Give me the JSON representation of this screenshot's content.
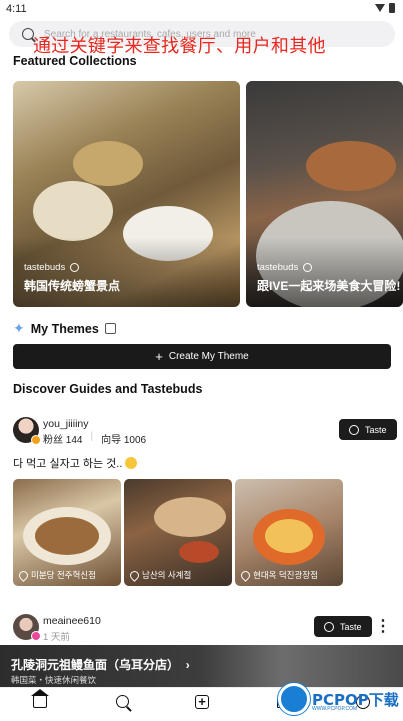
{
  "status_bar": {
    "time": "4:11"
  },
  "search": {
    "placeholder": "Search for a restaurants, cafes, users and more"
  },
  "overlay_banner": "通过关键字来查找餐厅、用户和其他",
  "featured": {
    "heading": "Featured Collections",
    "cards": [
      {
        "tag": "tastebuds",
        "title": "韩国传统螃蟹景点"
      },
      {
        "tag": "tastebuds",
        "title": "跟IVE一起来场美食大冒险!"
      }
    ]
  },
  "themes": {
    "heading": "My Themes",
    "create_label": "Create My Theme"
  },
  "discover": {
    "heading": "Discover Guides and Tastebuds"
  },
  "posts": [
    {
      "username": "you_jiiiiny",
      "followers_label": "粉丝",
      "followers": "144",
      "guides_label": "向导",
      "guides": "1006",
      "taste_label": "Taste",
      "text": "다 먹고 실자고 하는 것..",
      "locations": [
        "미분당 전주혁신점",
        "남산의 사계절",
        "현대옥 덕진광장점"
      ]
    },
    {
      "username": "meainee610",
      "time_ago": "1 天前",
      "taste_label": "Taste",
      "more": "⋮"
    }
  ],
  "bottom_banner": {
    "title": "孔陵洞元祖鳗鱼面（乌耳分店）",
    "arrow": "›",
    "subtitle": "韩国菜・快速休闲餐饮"
  },
  "watermark": {
    "brand": "PCPOP下载",
    "sub": "WWW.PCPOP.COM"
  },
  "colors": {
    "banner_red": "#e8281e",
    "dark_button": "#1a1a1a",
    "accent_blue": "#6aa4e6"
  }
}
